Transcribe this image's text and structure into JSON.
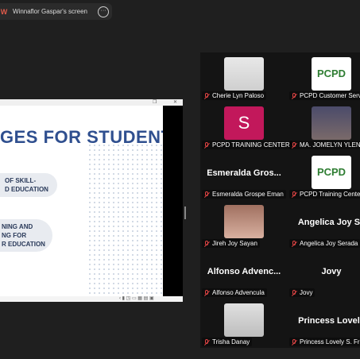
{
  "topbar": {
    "badge": "W",
    "title": "Winnaflor Gaspar's screen",
    "more": "···"
  },
  "share": {
    "slide_title": "GES FOR STUDENTS",
    "pill1_line1": "OF SKILL-",
    "pill1_line2": "D EDUCATION",
    "pill2_line1": "NING AND",
    "pill2_line2": "NG FOR",
    "pill2_line3": "R EDUCATION"
  },
  "gallery": [
    {
      "name": "Cherie Lyn Paloso",
      "type": "photo"
    },
    {
      "name": "PCPD Customer Servi",
      "type": "logo",
      "logo": "PCPD"
    },
    {
      "name": "PCPD TRAINING CENTER",
      "type": "letter",
      "letter": "S"
    },
    {
      "name": "MA. JOMELYN YLEN",
      "type": "photo"
    },
    {
      "name": "Esmeralda Grospe Eman",
      "type": "text",
      "big": "Esmeralda Gros..."
    },
    {
      "name": "PCPD Training Center Inc",
      "type": "logo",
      "logo": "PCPD"
    },
    {
      "name": "Jireh Joy Sayan",
      "type": "photo"
    },
    {
      "name": "Angelica Joy Serada",
      "type": "text",
      "big": "Angelica Joy Se"
    },
    {
      "name": "Alfonso Advencula",
      "type": "text",
      "big": "Alfonso Advenc..."
    },
    {
      "name": "Jovy",
      "type": "text",
      "big": "Jovy"
    },
    {
      "name": "Trisha Danay",
      "type": "photo"
    },
    {
      "name": "Princess Lovely S. Fria",
      "type": "text",
      "big": "Princess Lovely"
    }
  ]
}
